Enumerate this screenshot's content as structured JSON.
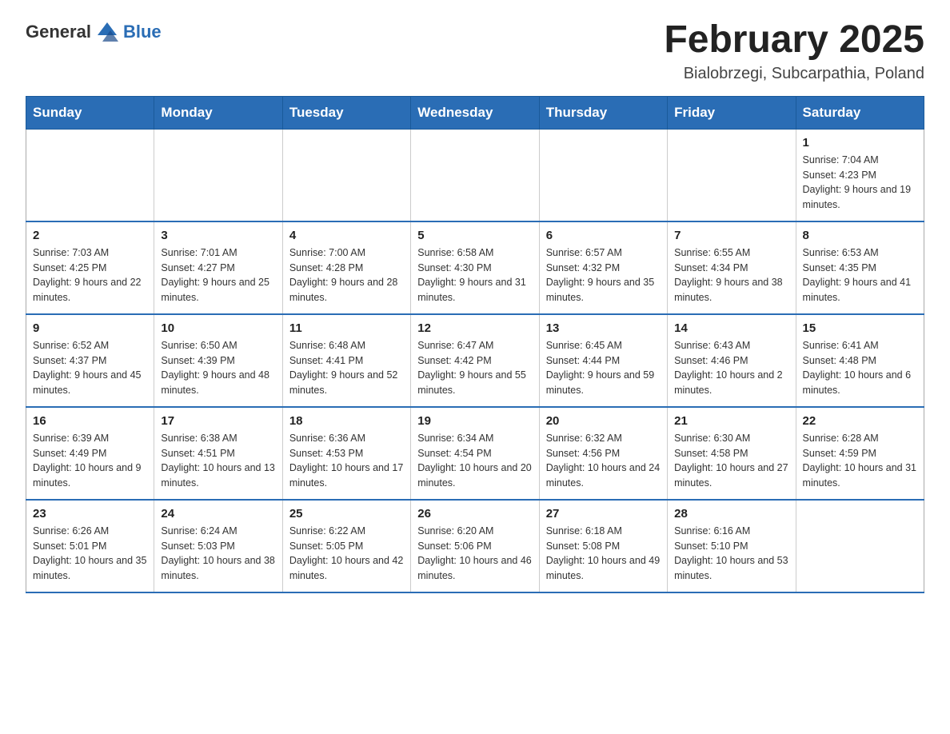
{
  "logo": {
    "general": "General",
    "blue": "Blue"
  },
  "title": "February 2025",
  "location": "Bialobrzegi, Subcarpathia, Poland",
  "weekdays": [
    "Sunday",
    "Monday",
    "Tuesday",
    "Wednesday",
    "Thursday",
    "Friday",
    "Saturday"
  ],
  "weeks": [
    [
      {
        "day": "",
        "info": ""
      },
      {
        "day": "",
        "info": ""
      },
      {
        "day": "",
        "info": ""
      },
      {
        "day": "",
        "info": ""
      },
      {
        "day": "",
        "info": ""
      },
      {
        "day": "",
        "info": ""
      },
      {
        "day": "1",
        "info": "Sunrise: 7:04 AM\nSunset: 4:23 PM\nDaylight: 9 hours and 19 minutes."
      }
    ],
    [
      {
        "day": "2",
        "info": "Sunrise: 7:03 AM\nSunset: 4:25 PM\nDaylight: 9 hours and 22 minutes."
      },
      {
        "day": "3",
        "info": "Sunrise: 7:01 AM\nSunset: 4:27 PM\nDaylight: 9 hours and 25 minutes."
      },
      {
        "day": "4",
        "info": "Sunrise: 7:00 AM\nSunset: 4:28 PM\nDaylight: 9 hours and 28 minutes."
      },
      {
        "day": "5",
        "info": "Sunrise: 6:58 AM\nSunset: 4:30 PM\nDaylight: 9 hours and 31 minutes."
      },
      {
        "day": "6",
        "info": "Sunrise: 6:57 AM\nSunset: 4:32 PM\nDaylight: 9 hours and 35 minutes."
      },
      {
        "day": "7",
        "info": "Sunrise: 6:55 AM\nSunset: 4:34 PM\nDaylight: 9 hours and 38 minutes."
      },
      {
        "day": "8",
        "info": "Sunrise: 6:53 AM\nSunset: 4:35 PM\nDaylight: 9 hours and 41 minutes."
      }
    ],
    [
      {
        "day": "9",
        "info": "Sunrise: 6:52 AM\nSunset: 4:37 PM\nDaylight: 9 hours and 45 minutes."
      },
      {
        "day": "10",
        "info": "Sunrise: 6:50 AM\nSunset: 4:39 PM\nDaylight: 9 hours and 48 minutes."
      },
      {
        "day": "11",
        "info": "Sunrise: 6:48 AM\nSunset: 4:41 PM\nDaylight: 9 hours and 52 minutes."
      },
      {
        "day": "12",
        "info": "Sunrise: 6:47 AM\nSunset: 4:42 PM\nDaylight: 9 hours and 55 minutes."
      },
      {
        "day": "13",
        "info": "Sunrise: 6:45 AM\nSunset: 4:44 PM\nDaylight: 9 hours and 59 minutes."
      },
      {
        "day": "14",
        "info": "Sunrise: 6:43 AM\nSunset: 4:46 PM\nDaylight: 10 hours and 2 minutes."
      },
      {
        "day": "15",
        "info": "Sunrise: 6:41 AM\nSunset: 4:48 PM\nDaylight: 10 hours and 6 minutes."
      }
    ],
    [
      {
        "day": "16",
        "info": "Sunrise: 6:39 AM\nSunset: 4:49 PM\nDaylight: 10 hours and 9 minutes."
      },
      {
        "day": "17",
        "info": "Sunrise: 6:38 AM\nSunset: 4:51 PM\nDaylight: 10 hours and 13 minutes."
      },
      {
        "day": "18",
        "info": "Sunrise: 6:36 AM\nSunset: 4:53 PM\nDaylight: 10 hours and 17 minutes."
      },
      {
        "day": "19",
        "info": "Sunrise: 6:34 AM\nSunset: 4:54 PM\nDaylight: 10 hours and 20 minutes."
      },
      {
        "day": "20",
        "info": "Sunrise: 6:32 AM\nSunset: 4:56 PM\nDaylight: 10 hours and 24 minutes."
      },
      {
        "day": "21",
        "info": "Sunrise: 6:30 AM\nSunset: 4:58 PM\nDaylight: 10 hours and 27 minutes."
      },
      {
        "day": "22",
        "info": "Sunrise: 6:28 AM\nSunset: 4:59 PM\nDaylight: 10 hours and 31 minutes."
      }
    ],
    [
      {
        "day": "23",
        "info": "Sunrise: 6:26 AM\nSunset: 5:01 PM\nDaylight: 10 hours and 35 minutes."
      },
      {
        "day": "24",
        "info": "Sunrise: 6:24 AM\nSunset: 5:03 PM\nDaylight: 10 hours and 38 minutes."
      },
      {
        "day": "25",
        "info": "Sunrise: 6:22 AM\nSunset: 5:05 PM\nDaylight: 10 hours and 42 minutes."
      },
      {
        "day": "26",
        "info": "Sunrise: 6:20 AM\nSunset: 5:06 PM\nDaylight: 10 hours and 46 minutes."
      },
      {
        "day": "27",
        "info": "Sunrise: 6:18 AM\nSunset: 5:08 PM\nDaylight: 10 hours and 49 minutes."
      },
      {
        "day": "28",
        "info": "Sunrise: 6:16 AM\nSunset: 5:10 PM\nDaylight: 10 hours and 53 minutes."
      },
      {
        "day": "",
        "info": ""
      }
    ]
  ]
}
